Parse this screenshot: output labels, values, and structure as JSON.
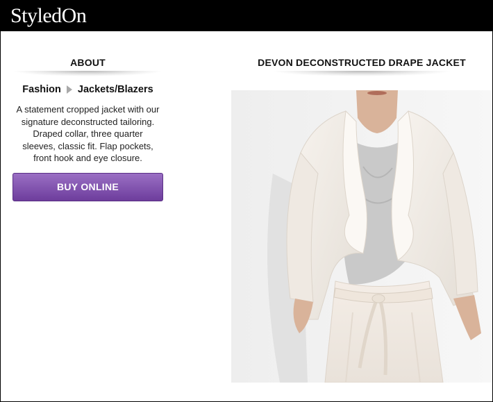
{
  "header": {
    "logo_text": "StyledOn"
  },
  "about": {
    "heading": "ABOUT",
    "breadcrumb": [
      "Fashion",
      "Jackets/Blazers"
    ],
    "description": "A statement cropped jacket with our signature deconstructed tailoring. Draped collar, three quarter sleeves, classic fit. Flap pockets, front hook and eye closure.",
    "buy_button": "BUY ONLINE"
  },
  "product": {
    "title": "DEVON DECONSTRUCTED DRAPE JACKET"
  },
  "colors": {
    "topbar": "#000000",
    "button_top": "#9a6fc4",
    "button_bottom": "#6d3d9c"
  }
}
